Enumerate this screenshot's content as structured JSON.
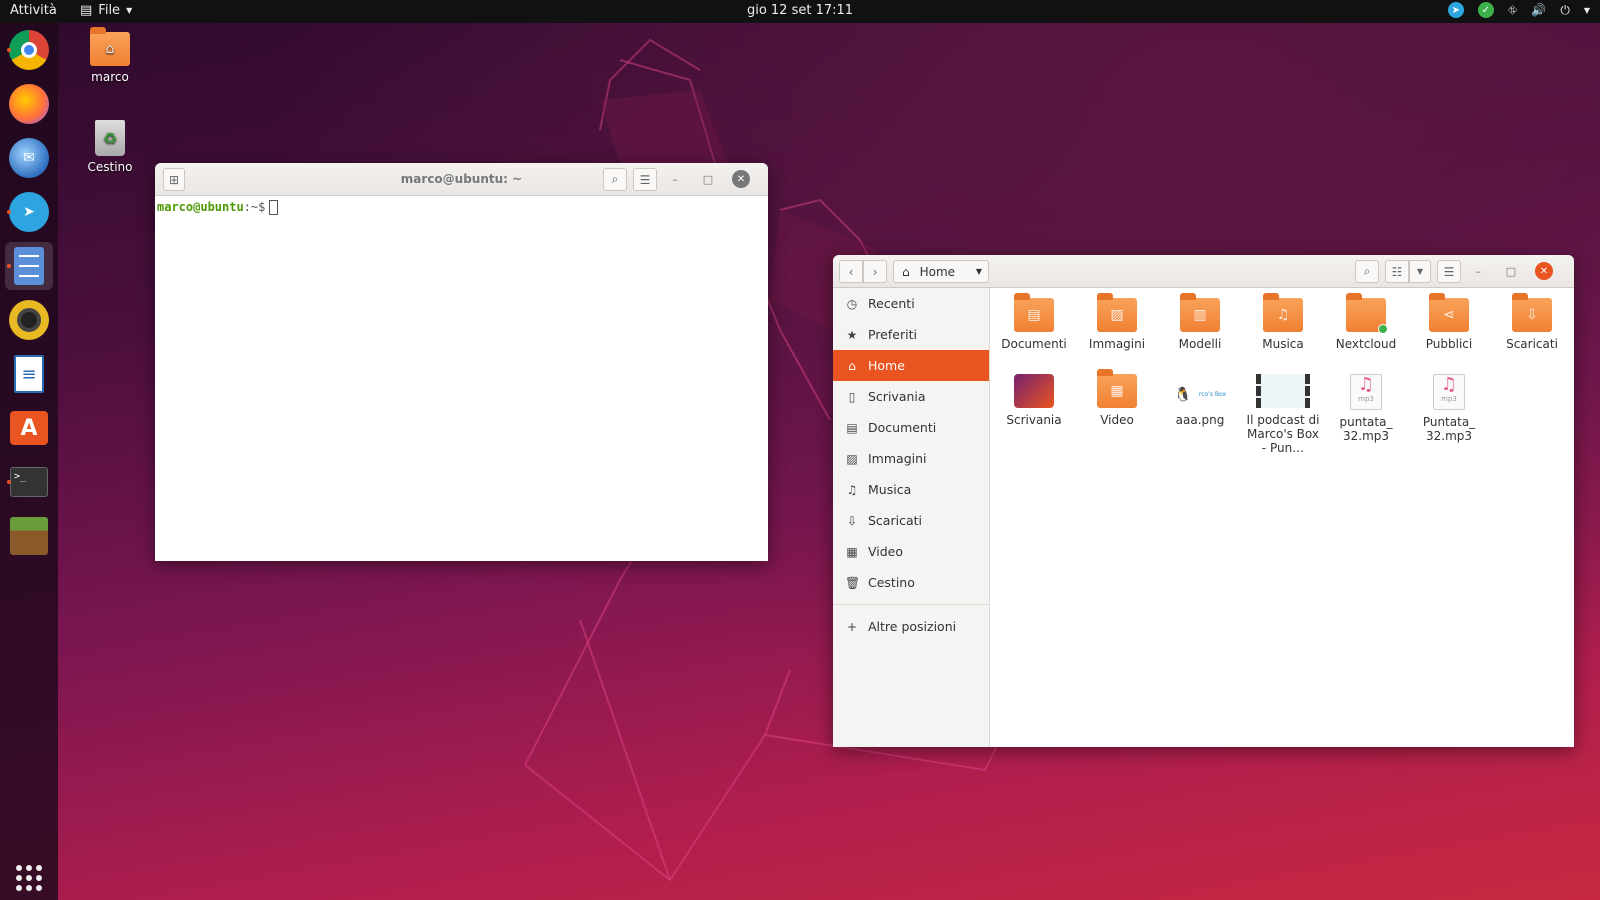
{
  "topbar": {
    "activities": "Attività",
    "app_menu": "File",
    "clock": "gio 12 set  17:11"
  },
  "dock": {
    "apps": [
      {
        "name": "Chrome",
        "icon": "chrome-icon",
        "color": "#db4437"
      },
      {
        "name": "Firefox",
        "icon": "firefox-icon",
        "color": "#ff7139"
      },
      {
        "name": "Thunderbird",
        "icon": "thunderbird-icon",
        "color": "#2f6fbf"
      },
      {
        "name": "Telegram",
        "icon": "telegram-icon",
        "color": "#2ca5e0"
      },
      {
        "name": "Files",
        "icon": "files-icon",
        "color": "#5b8fd8"
      },
      {
        "name": "Rhythmbox",
        "icon": "rhythmbox-icon",
        "color": "#e8b923"
      },
      {
        "name": "LibreOffice Writer",
        "icon": "writer-icon",
        "color": "#2a6bb5"
      },
      {
        "name": "Ubuntu Software",
        "icon": "software-icon",
        "color": "#e95420"
      },
      {
        "name": "Terminal",
        "icon": "terminal-icon",
        "color": "#333333"
      },
      {
        "name": "Minecraft",
        "icon": "minecraft-icon",
        "color": "#6a9c3a"
      }
    ]
  },
  "desktop": {
    "home_label": "marco",
    "trash_label": "Cestino"
  },
  "terminal": {
    "title": "marco@ubuntu: ~",
    "prompt_user": "marco@ubuntu",
    "prompt_path": ":~$"
  },
  "files": {
    "location": "Home",
    "sidebar": {
      "recent": "Recenti",
      "starred": "Preferiti",
      "home": "Home",
      "desktop": "Scrivania",
      "documents": "Documenti",
      "pictures": "Immagini",
      "music": "Musica",
      "downloads": "Scaricati",
      "videos": "Video",
      "trash": "Cestino",
      "other": "Altre posizioni"
    },
    "items": {
      "documenti": "Documenti",
      "immagini": "Immagini",
      "modelli": "Modelli",
      "musica": "Musica",
      "nextcloud": "Nextcloud",
      "pubblici": "Pubblici",
      "scaricati": "Scaricati",
      "scrivania": "Scrivania",
      "video": "Video",
      "aaa": "aaa.png",
      "podcast": "Il podcast di Marco's Box - Pun…",
      "puntata1": "puntata_ 32.mp3",
      "puntata2": "Puntata_ 32.mp3"
    },
    "mp3_tag": "mp3",
    "accent_color": "#e95420"
  }
}
